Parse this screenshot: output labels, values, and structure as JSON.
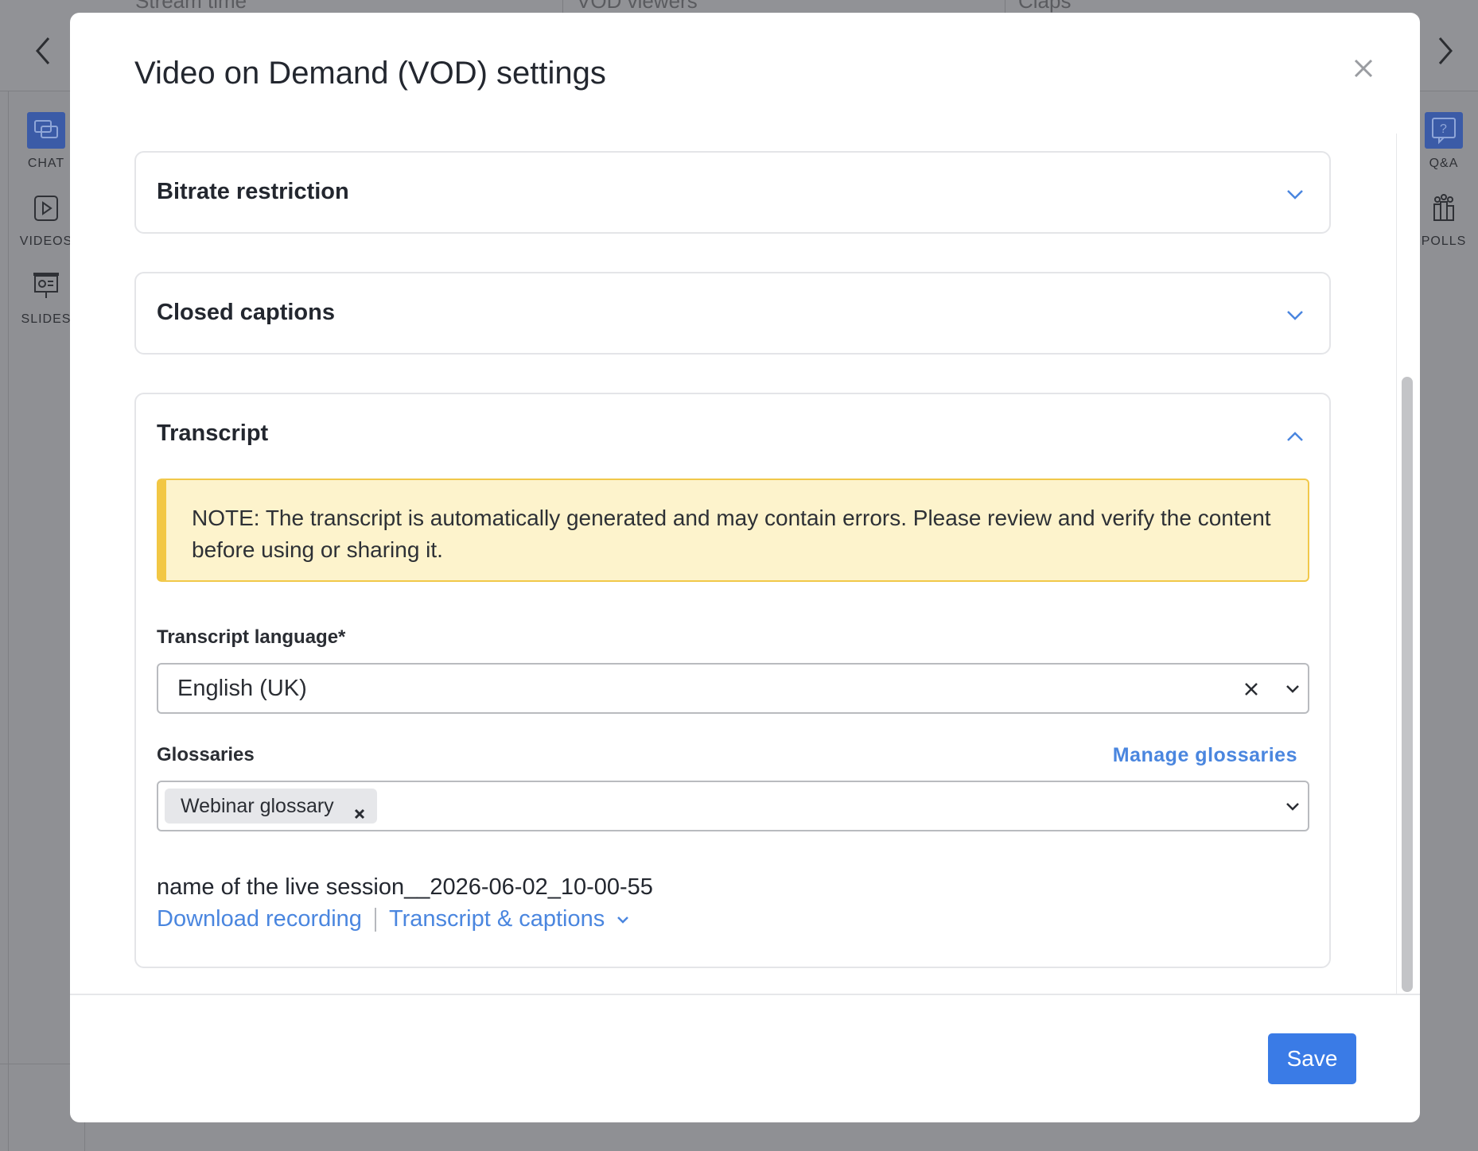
{
  "background": {
    "header_columns": [
      "Stream time",
      "VOD viewers",
      "Claps"
    ],
    "left_rail": [
      {
        "label": "CHAT",
        "icon": "chat-icon",
        "active": true
      },
      {
        "label": "VIDEOS",
        "icon": "video-icon",
        "active": false
      },
      {
        "label": "SLIDES",
        "icon": "slides-icon",
        "active": false
      }
    ],
    "right_rail": [
      {
        "label": "Q&A",
        "icon": "question-icon",
        "active": true
      },
      {
        "label": "POLLS",
        "icon": "polls-icon",
        "active": false
      }
    ]
  },
  "modal": {
    "title": "Video on Demand (VOD) settings",
    "sections": {
      "bitrate": {
        "title": "Bitrate restriction",
        "expanded": false
      },
      "captions": {
        "title": "Closed captions",
        "expanded": false
      },
      "transcript": {
        "title": "Transcript",
        "expanded": true,
        "note": "NOTE: The transcript is automatically generated and may contain errors. Please review and verify the content before using or sharing it.",
        "language_label": "Transcript language*",
        "language_value": "English (UK)",
        "glossaries_label": "Glossaries",
        "manage_glossaries": "Manage glossaries",
        "glossary_chips": [
          "Webinar glossary"
        ],
        "session_name": "name of the live session__2026-06-02_10-00-55",
        "download_link": "Download recording",
        "captions_link": "Transcript & captions"
      }
    },
    "save_label": "Save"
  },
  "colors": {
    "accent": "#3a7be6",
    "link": "#4a86df",
    "note_bg": "#fdf3cc",
    "note_border": "#f2c744",
    "rail_active": "#3b5ba7"
  }
}
